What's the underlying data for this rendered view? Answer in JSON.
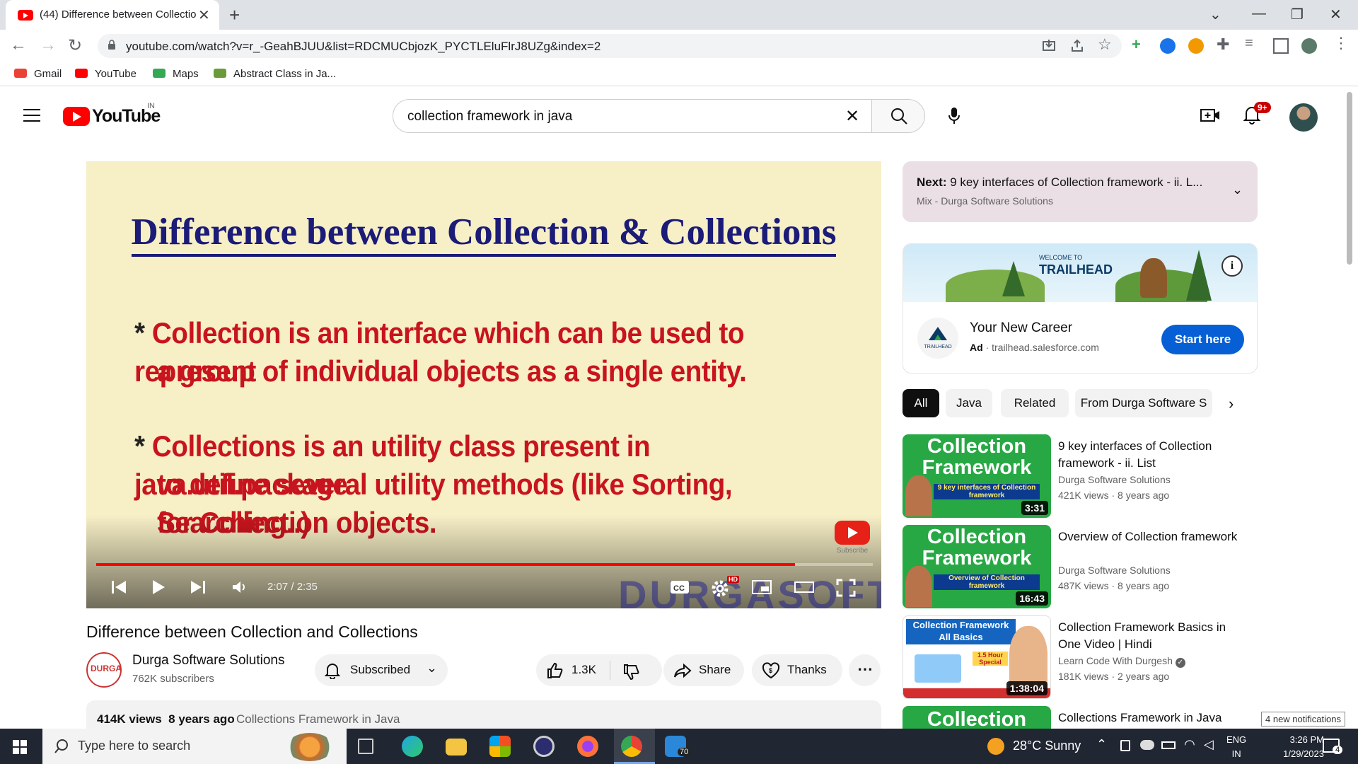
{
  "browser": {
    "tab_title": "(44) Difference between Collectio",
    "url": "youtube.com/watch?v=r_-GeahBJUU&list=RDCMUCbjozK_PYCTLEluFlrJ8UZg&index=2",
    "bookmarks": [
      "Gmail",
      "YouTube",
      "Maps",
      "Abstract Class in Ja..."
    ]
  },
  "header": {
    "logo_text": "YouTube",
    "country": "IN",
    "search_query": "collection framework in java",
    "notification_badge": "9+"
  },
  "player": {
    "slide_title": "Difference between Collection & Collections",
    "bullet1_line1": "Collection is an interface which can be used to represent",
    "bullet1_line2": "a group of individual objects as a single entity.",
    "bullet2_line1": "Collections is an utility class present in java.util.package",
    "bullet2_line2": "to define several utility methods (like Sorting, Searching..)",
    "bullet2_line3": "for Collection objects.",
    "watermark": "DURGASOFT",
    "subscribe_watermark": "Subscribe",
    "time": "2:07 / 2:35",
    "progress": 0.9,
    "hd_badge": "HD"
  },
  "video": {
    "title": "Difference between Collection and Collections",
    "channel_name": "Durga Software Solutions",
    "channel_avatar_text": "DURGA",
    "subscribers": "762K subscribers",
    "subscribed_label": "Subscribed",
    "likes": "1.3K",
    "share_label": "Share",
    "thanks_label": "Thanks",
    "views": "414K views",
    "age": "8 years ago",
    "tags": "Collections Framework  in Java"
  },
  "next": {
    "label": "Next:",
    "title": "9 key interfaces of Collection framework - ii. L...",
    "subtitle": "Mix - Durga Software Solutions"
  },
  "ad": {
    "banner_small": "WELCOME TO",
    "banner_brand": "TRAILHEAD",
    "logo_text": "TRAILHEAD",
    "title": "Your New Career",
    "ad_label": "Ad",
    "domain": "trailhead.salesforce.com",
    "cta": "Start here"
  },
  "chips": [
    "All",
    "Java",
    "Related",
    "From Durga Software S"
  ],
  "recommendations": [
    {
      "thumb_text": "Collection Framework",
      "thumb_sub": "9 key interfaces of Collection framework",
      "duration": "3:31",
      "title": "9 key interfaces of Collection framework - ii. List",
      "channel": "Durga Software Solutions",
      "views": "421K views · 8 years ago"
    },
    {
      "thumb_text": "Collection Framework",
      "thumb_sub": "Overview of Collection framework",
      "duration": "16:43",
      "title": "Overview of Collection framework",
      "channel": "Durga Software Solutions",
      "views": "487K views · 8 years ago"
    },
    {
      "thumb_text": "Collection Framework All Basics",
      "thumb_sub": "1.5 Hour Special",
      "duration": "1:38:04",
      "title": "Collection Framework Basics in One Video | Hindi",
      "channel": "Learn Code With Durgesh",
      "views": "181K views · 2 years ago"
    },
    {
      "thumb_text": "Collection",
      "thumb_sub": "",
      "duration": "",
      "title": "Collections Framework in Java",
      "channel": "",
      "views": ""
    }
  ],
  "notification_tip": "4 new notifications",
  "taskbar": {
    "search_placeholder": "Type here to search",
    "weather": "28°C  Sunny",
    "lang1": "ENG",
    "lang2": "IN",
    "time": "3:26 PM",
    "date": "1/29/2023",
    "app_badge": "70",
    "notif_count": "4"
  },
  "colors": {
    "accent": "#ff0000",
    "cta": "#065fd4",
    "slide_text": "#c8141e",
    "slide_title": "#1b1b78"
  }
}
